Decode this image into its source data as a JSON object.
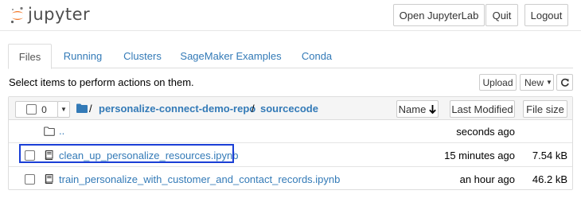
{
  "header": {
    "logo_text": "jupyter",
    "open_jupyterlab_label": "Open JupyterLab",
    "quit_label": "Quit",
    "logout_label": "Logout"
  },
  "tabs": [
    {
      "label": "Files",
      "active": true
    },
    {
      "label": "Running",
      "active": false
    },
    {
      "label": "Clusters",
      "active": false
    },
    {
      "label": "SageMaker Examples",
      "active": false
    },
    {
      "label": "Conda",
      "active": false
    }
  ],
  "toolbar": {
    "info_text": "Select items to perform actions on them.",
    "upload_label": "Upload",
    "new_label": "New"
  },
  "list_header": {
    "selected_count": "0",
    "breadcrumb": [
      "personalize-connect-demo-repo",
      "sourcecode"
    ],
    "separator": "/",
    "sort_name_label": "Name",
    "last_modified_label": "Last Modified",
    "file_size_label": "File size"
  },
  "rows": [
    {
      "name": "..",
      "type": "folder",
      "modified": "seconds ago",
      "size": ""
    },
    {
      "name": "clean_up_personalize_resources.ipynb",
      "type": "notebook",
      "modified": "15 minutes ago",
      "size": "7.54 kB",
      "highlighted": true
    },
    {
      "name": "train_personalize_with_customer_and_contact_records.ipynb",
      "type": "notebook",
      "modified": "an hour ago",
      "size": "46.2 kB"
    }
  ],
  "colors": {
    "link": "#337ab7",
    "logo_orange": "#f37726",
    "highlight_border": "#1a3fd6"
  }
}
